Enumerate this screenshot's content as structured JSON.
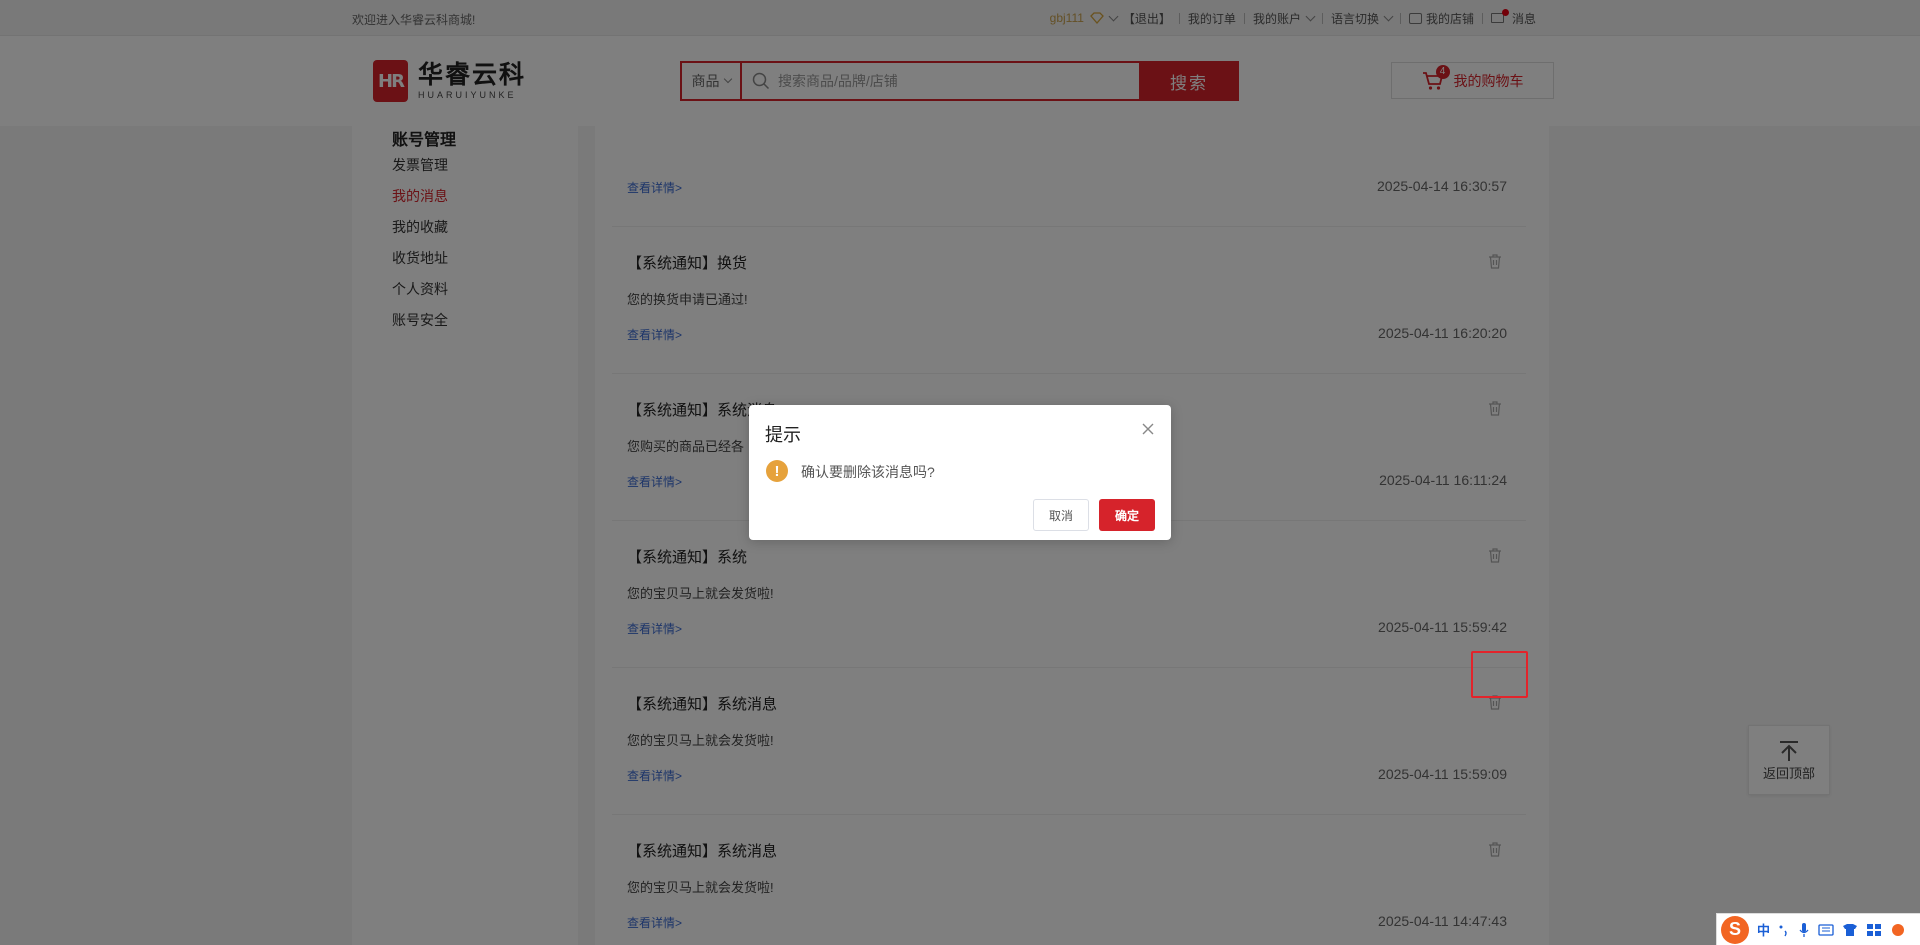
{
  "topbar": {
    "welcome": "欢迎进入华睿云科商城!",
    "username": "gbj111",
    "logout": "【退出】",
    "my_orders": "我的订单",
    "my_account": "我的账户",
    "language": "语言切换",
    "my_shop": "我的店铺",
    "messages": "消息"
  },
  "header": {
    "logo_mark": "HR",
    "logo_cn": "华睿云科",
    "logo_en": "HUARUIYUNKE",
    "search_category": "商品",
    "search_placeholder": "搜索商品/品牌/店铺",
    "search_button": "搜索",
    "cart_label": "我的购物车",
    "cart_count": "4"
  },
  "sidebar": {
    "title": "账号管理",
    "items": [
      {
        "label": "发票管理"
      },
      {
        "label": "我的消息"
      },
      {
        "label": "我的收藏"
      },
      {
        "label": "收货地址"
      },
      {
        "label": "个人资料"
      },
      {
        "label": "账号安全"
      }
    ],
    "active_index": 1
  },
  "messages": [
    {
      "title": "",
      "body": "",
      "link": "查看详情>",
      "time": "2025-04-14 16:30:57"
    },
    {
      "title": "【系统通知】换货",
      "body": "您的换货申请已通过!",
      "link": "查看详情>",
      "time": "2025-04-11 16:20:20"
    },
    {
      "title": "【系统通知】系统消息",
      "body": "您购买的商品已经各",
      "link": "查看详情>",
      "time": "2025-04-11 16:11:24"
    },
    {
      "title": "【系统通知】系统",
      "body": "您的宝贝马上就会发货啦!",
      "link": "查看详情>",
      "time": "2025-04-11 15:59:42"
    },
    {
      "title": "【系统通知】系统消息",
      "body": "您的宝贝马上就会发货啦!",
      "link": "查看详情>",
      "time": "2025-04-11 15:59:09"
    },
    {
      "title": "【系统通知】系统消息",
      "body": "您的宝贝马上就会发货啦!",
      "link": "查看详情>",
      "time": "2025-04-11 14:47:43"
    }
  ],
  "back_to_top": "返回顶部",
  "dialog": {
    "title": "提示",
    "message": "确认要删除该消息吗?",
    "cancel": "取消",
    "confirm": "确定"
  },
  "ime": {
    "logo": "S",
    "lang": "中"
  },
  "colors": {
    "brand_red": "#d6232b",
    "link_blue": "#3b6bd3",
    "warning_orange": "#e6a23c"
  }
}
